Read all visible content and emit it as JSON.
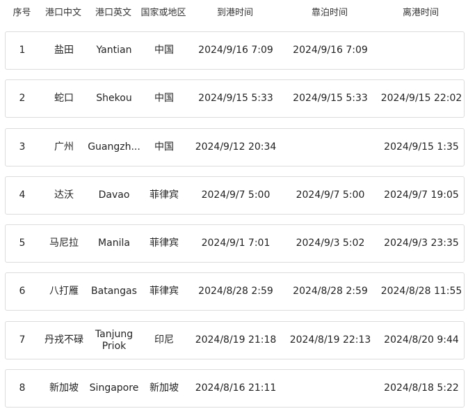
{
  "headers": {
    "idx": "序号",
    "port_cn": "港口中文",
    "port_en": "港口英文",
    "country": "国家或地区",
    "arrival": "到港时间",
    "berthing": "靠泊时间",
    "departure": "离港时间"
  },
  "rows": [
    {
      "idx": "1",
      "port_cn": "盐田",
      "port_en": "Yantian",
      "country": "中国",
      "arrival": "2024/9/16 7:09",
      "berthing": "2024/9/16 7:09",
      "departure": ""
    },
    {
      "idx": "2",
      "port_cn": "蛇口",
      "port_en": "Shekou",
      "country": "中国",
      "arrival": "2024/9/15 5:33",
      "berthing": "2024/9/15 5:33",
      "departure": "2024/9/15 22:02"
    },
    {
      "idx": "3",
      "port_cn": "广州",
      "port_en": "Guangzh...",
      "country": "中国",
      "arrival": "2024/9/12 20:34",
      "berthing": "",
      "departure": "2024/9/15 1:35"
    },
    {
      "idx": "4",
      "port_cn": "达沃",
      "port_en": "Davao",
      "country": "菲律宾",
      "arrival": "2024/9/7 5:00",
      "berthing": "2024/9/7 5:00",
      "departure": "2024/9/7 19:05"
    },
    {
      "idx": "5",
      "port_cn": "马尼拉",
      "port_en": "Manila",
      "country": "菲律宾",
      "arrival": "2024/9/1 7:01",
      "berthing": "2024/9/3 5:02",
      "departure": "2024/9/3 23:35"
    },
    {
      "idx": "6",
      "port_cn": "八打雁",
      "port_en": "Batangas",
      "country": "菲律宾",
      "arrival": "2024/8/28 2:59",
      "berthing": "2024/8/28 2:59",
      "departure": "2024/8/28 11:55"
    },
    {
      "idx": "7",
      "port_cn": "丹戎不碌",
      "port_en": "Tanjung Priok",
      "country": "印尼",
      "arrival": "2024/8/19 21:18",
      "berthing": "2024/8/19 22:13",
      "departure": "2024/8/20 9:44"
    },
    {
      "idx": "8",
      "port_cn": "新加坡",
      "port_en": "Singapore",
      "country": "新加坡",
      "arrival": "2024/8/16 21:11",
      "berthing": "",
      "departure": "2024/8/18 5:22"
    }
  ]
}
